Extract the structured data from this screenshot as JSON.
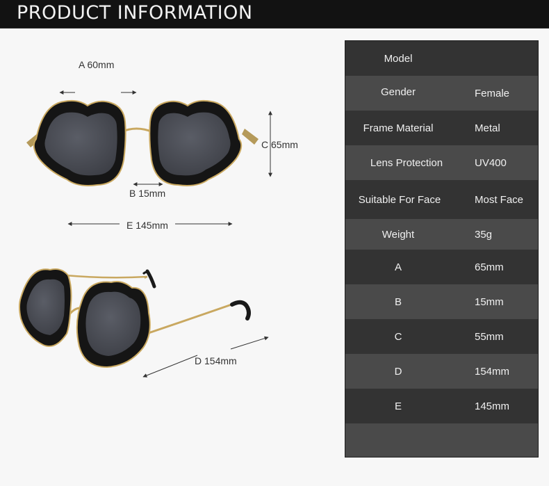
{
  "header": {
    "title": "PRODUCT INFORMATION"
  },
  "colors": {
    "header_bg": "#121212",
    "table_dark": "#333333",
    "table_light": "#4a4a4a",
    "frame": "#151515",
    "lens": "#4c4f57",
    "metal": "#c9a860"
  },
  "dimensions": {
    "a": "A 60mm",
    "b": "B 15mm",
    "c": "C 65mm",
    "d": "D  154mm",
    "e": "E 145mm"
  },
  "specs": [
    {
      "key": "Model",
      "value": ""
    },
    {
      "key": "Gender",
      "value": "Female"
    },
    {
      "key": "Frame Material",
      "value": "Metal"
    },
    {
      "key": "Lens Protection",
      "value": "UV400"
    },
    {
      "key": "Suitable For Face",
      "value": "Most Face"
    },
    {
      "key": "Weight",
      "value": "35g"
    },
    {
      "key": "A",
      "value": "65mm"
    },
    {
      "key": "B",
      "value": "15mm"
    },
    {
      "key": "C",
      "value": "55mm"
    },
    {
      "key": "D",
      "value": "154mm"
    },
    {
      "key": "E",
      "value": "145mm"
    }
  ]
}
